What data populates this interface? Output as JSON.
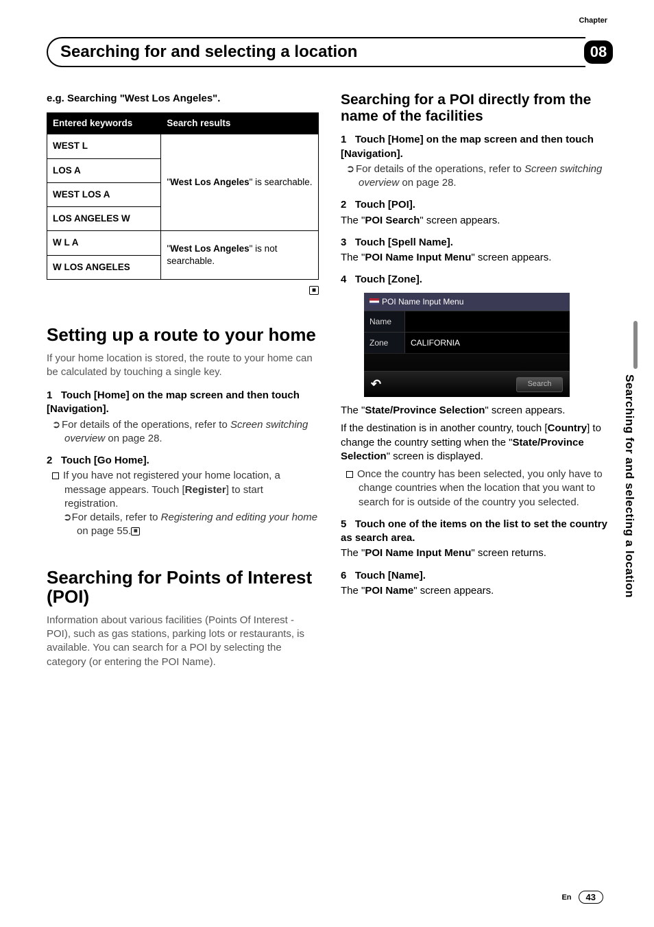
{
  "header": {
    "chapter_label": "Chapter",
    "chapter_number": "08",
    "title": "Searching for and selecting a location"
  },
  "side_tab": "Searching for and selecting a location",
  "footer": {
    "lang": "En",
    "page": "43"
  },
  "left": {
    "example_heading": "e.g. Searching \"West Los Angeles\".",
    "table": {
      "col1": "Entered keywords",
      "col2": "Search results",
      "rows_searchable": [
        "WEST L",
        "LOS A",
        "WEST LOS A",
        "LOS ANGELES W"
      ],
      "rows_not_searchable": [
        "W L A",
        "W LOS ANGELES"
      ],
      "result_searchable_prefix": "\"",
      "result_searchable_bold": "West Los Angeles",
      "result_searchable_suffix": "\" is searchable.",
      "result_not_prefix": "\"",
      "result_not_bold": "West Los Angeles",
      "result_not_suffix": "\" is not searchable."
    },
    "section1_title": "Setting up a route to your home",
    "section1_intro": "If your home location is stored, the route to your home can be calculated by touching a single key.",
    "s1_step1_num": "1",
    "s1_step1_title": "Touch [Home] on the map screen and then touch [Navigation].",
    "s1_step1_sub_lead": "For details of the operations, refer to ",
    "s1_step1_sub_italic": "Screen switching overview",
    "s1_step1_sub_tail": " on page 28.",
    "s1_step2_num": "2",
    "s1_step2_title": "Touch [Go Home].",
    "s1_step2_sub1_a": "If you have not registered your home location, a message appears. Touch [",
    "s1_step2_sub1_b": "Register",
    "s1_step2_sub1_c": "] to start registration.",
    "s1_step2_sub2_lead": "For details, refer to ",
    "s1_step2_sub2_italic": "Registering and editing your home",
    "s1_step2_sub2_tail": " on page 55.",
    "section2_title": "Searching for Points of Interest (POI)",
    "section2_intro": "Information about various facilities (Points Of Interest - POI), such as gas stations, parking lots or restaurants, is available. You can search for a POI by selecting the category (or entering the POI Name)."
  },
  "right": {
    "subtitle": "Searching for a POI directly from the name of the facilities",
    "step1_num": "1",
    "step1_title": "Touch [Home] on the map screen and then touch [Navigation].",
    "step1_sub_lead": "For details of the operations, refer to ",
    "step1_sub_italic": "Screen switching overview",
    "step1_sub_tail": " on page 28.",
    "step2_num": "2",
    "step2_title": "Touch [POI].",
    "step2_after_a": "The \"",
    "step2_after_b": "POI Search",
    "step2_after_c": "\" screen appears.",
    "step3_num": "3",
    "step3_title": "Touch [Spell Name].",
    "step3_after_a": "The \"",
    "step3_after_b": "POI Name Input Menu",
    "step3_after_c": "\" screen appears.",
    "step4_num": "4",
    "step4_title": "Touch [Zone].",
    "ui": {
      "title": "POI Name Input Menu",
      "row1_label": "Name",
      "row1_value": "",
      "row2_label": "Zone",
      "row2_value": "CALIFORNIA",
      "search": "Search"
    },
    "after4_a": "The \"",
    "after4_b": "State/Province Selection",
    "after4_c": "\" screen appears.",
    "after4_p2_a": "If the destination is in another country, touch [",
    "after4_p2_b": "Country",
    "after4_p2_c": "] to change the country setting when the \"",
    "after4_p2_d": "State/Province Selection",
    "after4_p2_e": "\" screen is displayed.",
    "after4_sub": "Once the country has been selected, you only have to change countries when the location that you want to search for is outside of the country you selected.",
    "step5_num": "5",
    "step5_title": "Touch one of the items on the list to set the country as search area.",
    "step5_after_a": "The \"",
    "step5_after_b": "POI Name Input Menu",
    "step5_after_c": "\" screen returns.",
    "step6_num": "6",
    "step6_title": "Touch [Name].",
    "step6_after_a": "The \"",
    "step6_after_b": "POI Name",
    "step6_after_c": "\" screen appears."
  }
}
